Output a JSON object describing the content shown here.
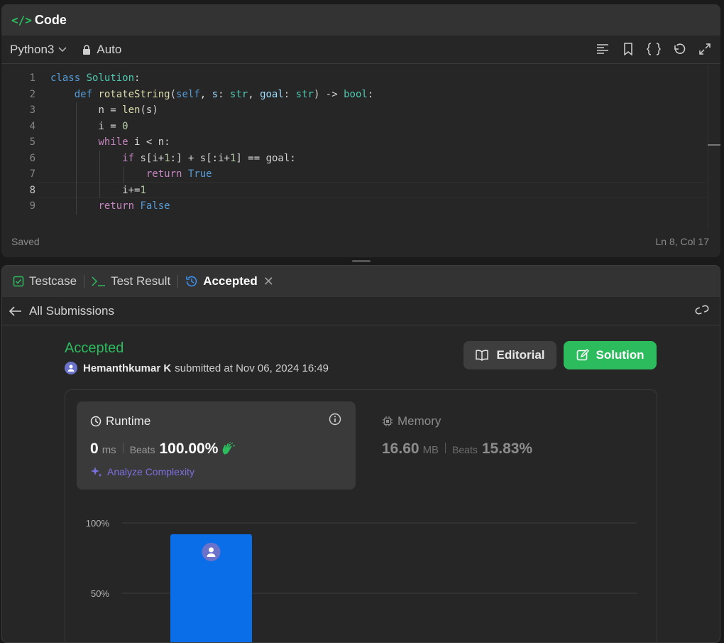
{
  "code_panel": {
    "title": "Code",
    "language": "Python3",
    "mode": "Auto",
    "status_left": "Saved",
    "status_right": "Ln 8, Col 17",
    "toolbar_icons": [
      "format-icon",
      "bookmark-icon",
      "braces-icon",
      "undo-icon",
      "expand-icon"
    ],
    "line_numbers": [
      "1",
      "2",
      "3",
      "4",
      "5",
      "6",
      "7",
      "8",
      "9"
    ],
    "active_line": 8,
    "code": [
      "class Solution:",
      "    def rotateString(self, s: str, goal: str) -> bool:",
      "        n = len(s)",
      "        i = 0",
      "        while i < n:",
      "            if s[i+1:] + s[:i+1] == goal:",
      "                return True",
      "            i+=1",
      "        return False"
    ]
  },
  "result_panel": {
    "tabs": [
      {
        "label": "Testcase",
        "icon": "checkbox-icon"
      },
      {
        "label": "Test Result",
        "icon": "terminal-icon"
      },
      {
        "label": "Accepted",
        "icon": "history-icon",
        "active": true
      }
    ],
    "back_label": "All Submissions",
    "status": "Accepted",
    "submitter_name": "Hemanthkumar K",
    "submitted_text": "submitted at Nov 06, 2024 16:49",
    "editorial_label": "Editorial",
    "solution_label": "Solution",
    "runtime": {
      "title": "Runtime",
      "value": "0",
      "unit": "ms",
      "beats_label": "Beats",
      "beats_value": "100.00%",
      "analyze_label": "Analyze Complexity"
    },
    "memory": {
      "title": "Memory",
      "value": "16.60",
      "unit": "MB",
      "beats_label": "Beats",
      "beats_value": "15.83%"
    }
  },
  "colors": {
    "accent_green": "#2cbb5d",
    "bar_blue": "#0a6ee8",
    "analyze_purple": "#7c6fe0"
  },
  "chart_data": {
    "type": "bar",
    "y_ticks": [
      "100%",
      "50%"
    ],
    "ylim": [
      0,
      100
    ],
    "series": [
      {
        "values": [
          92
        ]
      }
    ],
    "grid": true
  }
}
